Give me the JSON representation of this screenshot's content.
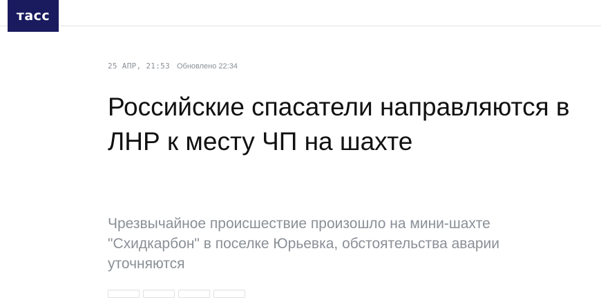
{
  "header": {
    "logo_text": "ТАСС"
  },
  "article": {
    "date": "25 АПР, 21:53",
    "updated": "Обновлено 22:34",
    "headline": "Российские спасатели направляются в ЛНР к месту ЧП на шахте",
    "lead": "Чрезвычайное происшествие произошло на мини-шахте \"Схидкарбон\" в поселке Юрьевка, обстоятельства аварии уточняются"
  },
  "colors": {
    "brand": "#1a1a5e",
    "meta_text": "#8a8f96",
    "headline_text": "#111111"
  },
  "share_buttons": [
    "share-button-1",
    "share-button-2",
    "share-button-3",
    "share-button-4"
  ]
}
